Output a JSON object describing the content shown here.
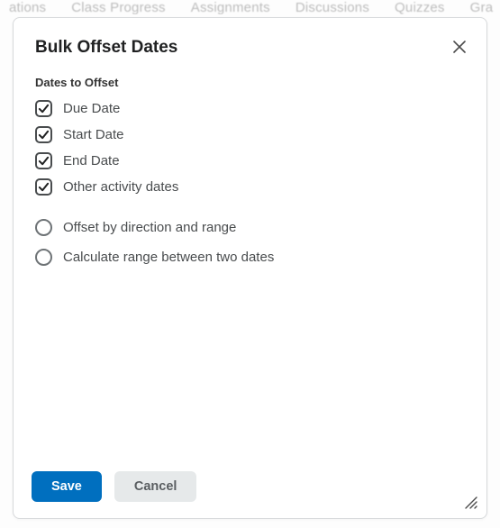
{
  "background_nav": [
    "ations",
    "Class Progress",
    "Assignments",
    "Discussions",
    "Quizzes",
    "Gra"
  ],
  "dialog": {
    "title": "Bulk Offset Dates",
    "section_label": "Dates to Offset",
    "checkboxes": [
      {
        "label": "Due Date",
        "checked": true
      },
      {
        "label": "Start Date",
        "checked": true
      },
      {
        "label": "End Date",
        "checked": true
      },
      {
        "label": "Other activity dates",
        "checked": true
      }
    ],
    "radios": [
      {
        "label": "Offset by direction and range",
        "selected": false
      },
      {
        "label": "Calculate range between two dates",
        "selected": false
      }
    ],
    "buttons": {
      "save": "Save",
      "cancel": "Cancel"
    }
  }
}
